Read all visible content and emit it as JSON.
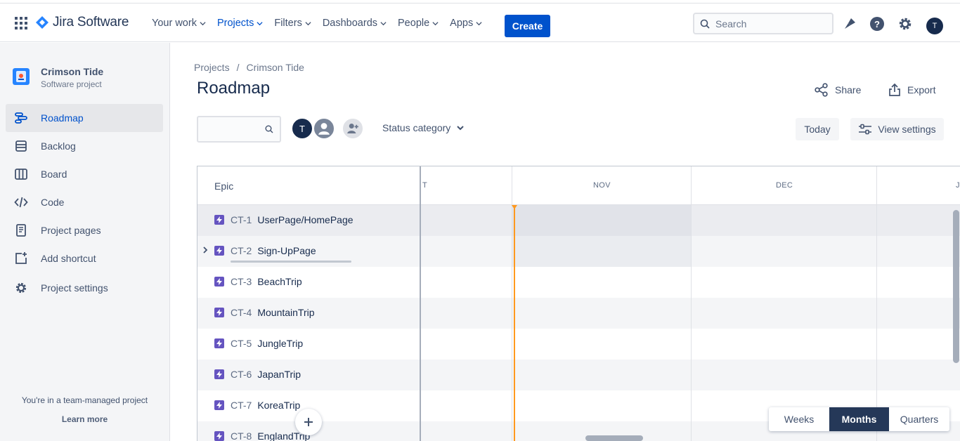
{
  "app": {
    "name": "Jira Software"
  },
  "nav": {
    "items": [
      {
        "label": "Your work"
      },
      {
        "label": "Projects"
      },
      {
        "label": "Filters"
      },
      {
        "label": "Dashboards"
      },
      {
        "label": "People"
      },
      {
        "label": "Apps"
      }
    ],
    "create_label": "Create",
    "search_placeholder": "Search",
    "user_initial": "T"
  },
  "sidebar": {
    "project_name": "Crimson Tide",
    "project_type": "Software project",
    "items": [
      {
        "label": "Roadmap"
      },
      {
        "label": "Backlog"
      },
      {
        "label": "Board"
      },
      {
        "label": "Code"
      },
      {
        "label": "Project pages"
      },
      {
        "label": "Add shortcut"
      },
      {
        "label": "Project settings"
      }
    ],
    "footer_text": "You're in a team-managed project",
    "footer_link": "Learn more"
  },
  "main": {
    "breadcrumb": [
      "Projects",
      "/",
      "Crimson Tide"
    ],
    "title": "Roadmap",
    "share_label": "Share",
    "export_label": "Export",
    "avatar_initial": "T",
    "status_category_label": "Status category",
    "today_label": "Today",
    "view_settings_label": "View settings"
  },
  "roadmap": {
    "epic_header": "Epic",
    "months": [
      "T",
      "NOV",
      "DEC",
      "JA"
    ],
    "epics": [
      {
        "key": "CT-1",
        "name": "UserPage/HomePage"
      },
      {
        "key": "CT-2",
        "name": "Sign-UpPage"
      },
      {
        "key": "CT-3",
        "name": "BeachTrip"
      },
      {
        "key": "CT-4",
        "name": "MountainTrip"
      },
      {
        "key": "CT-5",
        "name": "JungleTrip"
      },
      {
        "key": "CT-6",
        "name": "JapanTrip"
      },
      {
        "key": "CT-7",
        "name": "KoreaTrip"
      },
      {
        "key": "CT-8",
        "name": "EnglandTrip"
      }
    ]
  },
  "zoom": {
    "options": [
      "Weeks",
      "Months",
      "Quarters"
    ],
    "selected": "Months"
  },
  "colors": {
    "brand": "#0052cc",
    "epic": "#6554c0",
    "today": "#ff991f",
    "selected_zoom": "#253858"
  }
}
